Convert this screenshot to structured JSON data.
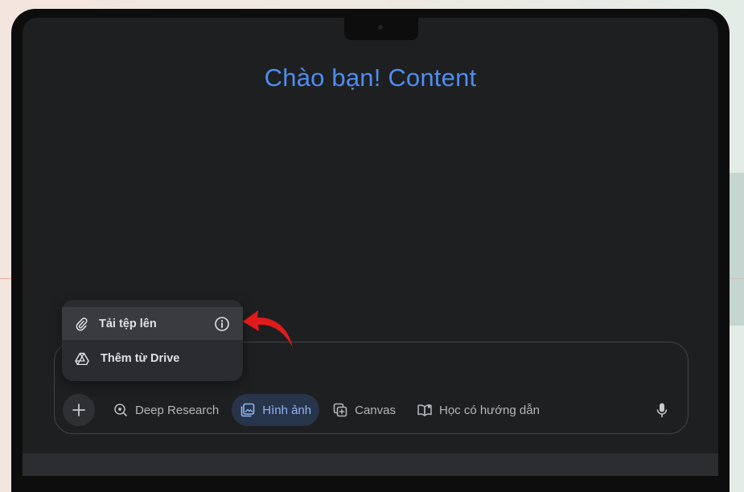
{
  "greeting": "Chào bạn! Content",
  "attach_menu": {
    "items": [
      {
        "label": "Tải tệp lên",
        "icon": "paperclip-icon",
        "trailing_icon": "info-icon"
      },
      {
        "label": "Thêm từ Drive",
        "icon": "google-drive-icon"
      }
    ]
  },
  "toolbar": {
    "tools": [
      {
        "label": "Deep Research",
        "icon": "deep-research-icon",
        "active": false
      },
      {
        "label": "Hình ảnh",
        "icon": "image-icon",
        "active": true
      },
      {
        "label": "Canvas",
        "icon": "canvas-icon",
        "active": false
      },
      {
        "label": "Học có hướng dẫn",
        "icon": "guided-learning-icon",
        "active": false
      }
    ],
    "plus_icon": "plus-icon",
    "mic_icon": "microphone-icon"
  },
  "colors": {
    "greeting": "#4e8df1",
    "active_tool_bg": "#28344a",
    "active_tool_text": "#8fb4f6",
    "annotation_arrow": "#e01b1b",
    "screen_bg": "#1e1f21"
  }
}
